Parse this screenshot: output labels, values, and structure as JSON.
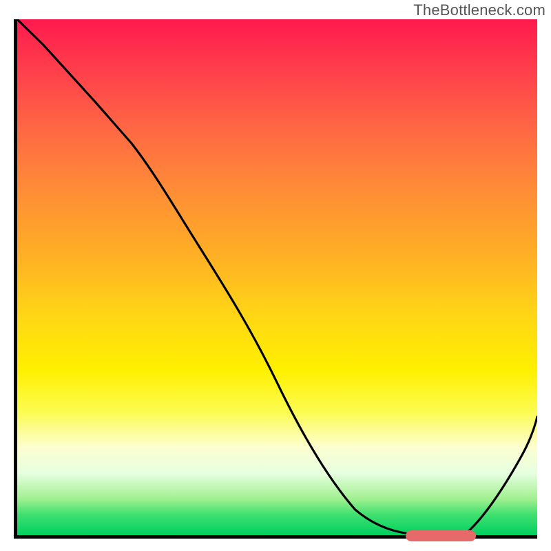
{
  "watermark": "TheBottleneck.com",
  "colors": {
    "top": "#ff1a4d",
    "mid": "#fff000",
    "bottom": "#00d060",
    "curve": "#000000",
    "marker": "#e66a6a",
    "axis": "#000000"
  },
  "chart_data": {
    "type": "line",
    "title": "",
    "xlabel": "",
    "ylabel": "",
    "xlim": [
      0,
      100
    ],
    "ylim": [
      0,
      100
    ],
    "grid": false,
    "legend": false,
    "description": "Single black curve over a vertical red→yellow→green gradient. Curve descends from top-left to a flat minimum near x≈78–86 at the very bottom, then rises towards the right edge.",
    "series": [
      {
        "name": "curve",
        "x": [
          0,
          5,
          15,
          22,
          30,
          40,
          50,
          60,
          70,
          78,
          82,
          86,
          92,
          97,
          100
        ],
        "values": [
          100,
          95,
          84,
          76,
          64,
          49,
          35,
          21,
          8,
          0,
          0,
          0,
          10,
          18,
          23
        ]
      }
    ],
    "marker": {
      "x_start": 78,
      "x_end": 86,
      "y": 0
    },
    "gradient_stops": [
      {
        "pos": 0.0,
        "color": "#ff1a4d"
      },
      {
        "pos": 0.1,
        "color": "#ff3f4c"
      },
      {
        "pos": 0.22,
        "color": "#ff6a43"
      },
      {
        "pos": 0.34,
        "color": "#ff8f35"
      },
      {
        "pos": 0.46,
        "color": "#ffb024"
      },
      {
        "pos": 0.58,
        "color": "#ffd814"
      },
      {
        "pos": 0.68,
        "color": "#fff000"
      },
      {
        "pos": 0.76,
        "color": "#fcfc50"
      },
      {
        "pos": 0.83,
        "color": "#fcfed0"
      },
      {
        "pos": 0.88,
        "color": "#e6ffe0"
      },
      {
        "pos": 0.93,
        "color": "#a0f090"
      },
      {
        "pos": 0.96,
        "color": "#40e070"
      },
      {
        "pos": 1.0,
        "color": "#00d060"
      }
    ]
  }
}
